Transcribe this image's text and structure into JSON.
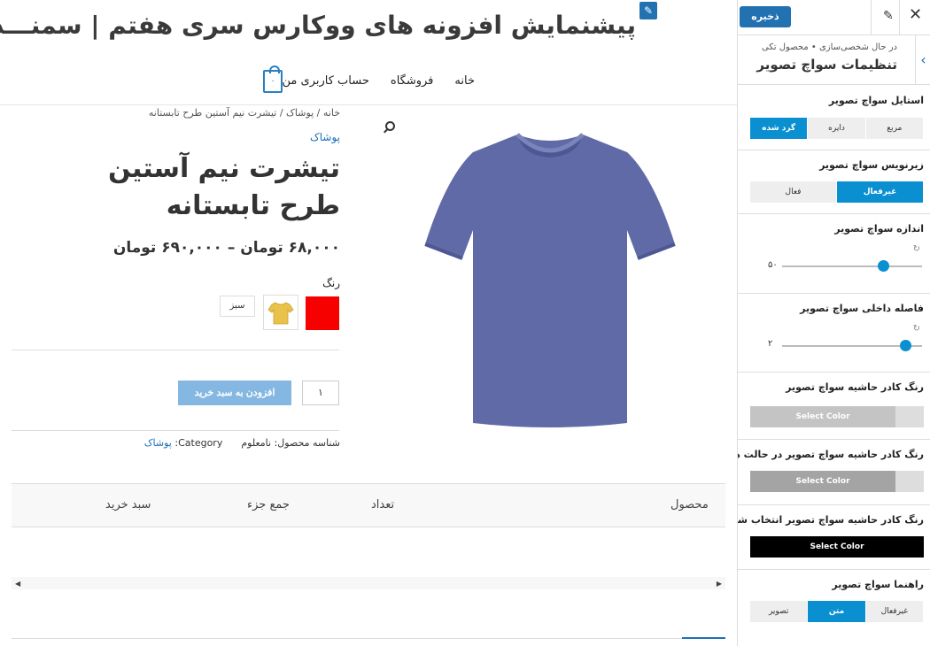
{
  "site": {
    "title": "پیشنمایش افزونه های ووکارس سری هفتم | سمنـــدون",
    "edit_icon": "pencil-icon",
    "nav": [
      "خانه",
      "فروشگاه",
      "حساب کاربری من"
    ],
    "cart_count": "۰"
  },
  "product": {
    "breadcrumb": "خانه / پوشاک / تیشرت نیم آستین طرح تابستانه",
    "category": "پوشاک",
    "title": "تیشرت نیم آستین طرح تابستانه",
    "price": "۶۸,۰۰۰ تومان – ۶۹۰,۰۰۰ تومان",
    "attribute_label": "رنگ",
    "swatches": {
      "color_hex": "#f70000",
      "image_color_hex": "#e8c24a",
      "text_label": "سبز"
    },
    "quantity": "۱",
    "add_to_cart": "افزودن به سبد خرید",
    "meta_sku_label": "شناسه محصول:",
    "meta_sku_value": "نامعلوم",
    "meta_category_label": "Category:",
    "meta_category_value": "پوشاک",
    "image_color_hex": "#5f6aa6"
  },
  "cart_table": {
    "headers": [
      "محصول",
      "تعداد",
      "جمع جزء",
      "سبد خرید"
    ]
  },
  "customizer": {
    "save": "ذخیره",
    "subtitle": "در حال شخصی‌سازی • محصول تکی",
    "heading": "تنظیمات سواچ تصویر",
    "style": {
      "label": "استایل سواچ تصویر",
      "options": [
        "مربع",
        "دایره",
        "گرد شده"
      ],
      "selected": "گرد شده"
    },
    "tooltip": {
      "label": "زیرنویس سواچ تصویر",
      "options": [
        "غیرفعال",
        "فعال"
      ],
      "selected": "غیرفعال"
    },
    "size": {
      "label": "اندازه سواچ تصویر",
      "value": "۵۰",
      "fraction": 0.72
    },
    "padding": {
      "label": "فاصله داخلی سواچ تصویر",
      "value": "۲",
      "fraction": 0.88
    },
    "border_color": {
      "label": "رنگ کادر حاشیه سواچ تصویر",
      "button": "Select Color",
      "color": "#c4c4c4"
    },
    "border_hover_color": {
      "label": "رنگ کادر حاشیه سواچ تصویر در حالت هاور",
      "button": "Select Color",
      "color": "#a4a4a4"
    },
    "border_selected_color": {
      "label": "رنگ کادر حاشیه سواچ تصویر انتخاب شده",
      "button": "Select Color",
      "color": "#000000"
    },
    "guide": {
      "label": "راهنما سواچ تصویر",
      "options": [
        "غیرفعال",
        "متن",
        "تصویر"
      ],
      "selected": "متن"
    },
    "accent": "#0a8fd1"
  }
}
